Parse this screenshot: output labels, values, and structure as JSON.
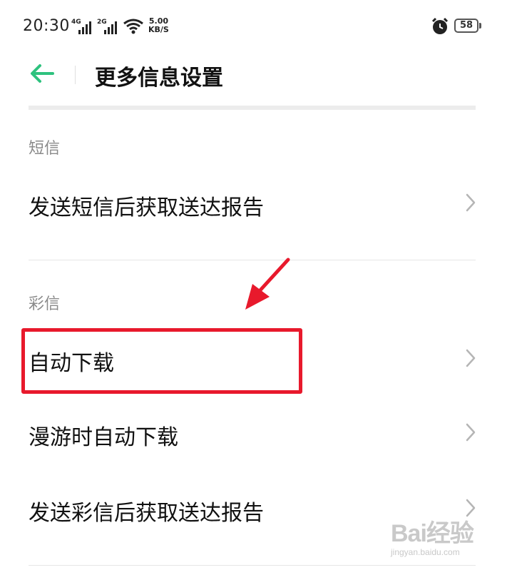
{
  "status_bar": {
    "time": "20:30",
    "signal_1_label": "4G",
    "signal_2_label": "2G",
    "net_speed_value": "5.00",
    "net_speed_unit": "KB/S",
    "battery": "58",
    "icons": [
      "signal-4g-icon",
      "signal-2g-icon",
      "wifi-icon",
      "alarm-icon",
      "battery-icon"
    ]
  },
  "header": {
    "back_icon": "arrow-left-icon",
    "title": "更多信息设置",
    "accent_color": "#2ec27e"
  },
  "sections": [
    {
      "label": "短信",
      "items": [
        {
          "label": "发送短信后获取送达报告"
        }
      ]
    },
    {
      "label": "彩信",
      "items": [
        {
          "label": "自动下载"
        },
        {
          "label": "漫游时自动下载"
        },
        {
          "label": "发送彩信后获取送达报告"
        }
      ]
    }
  ],
  "annotation": {
    "color": "#e8192c",
    "highlighted_item": "自动下载"
  },
  "watermark": {
    "logo_text": "Bai经验",
    "url": "jingyan.baidu.com"
  }
}
